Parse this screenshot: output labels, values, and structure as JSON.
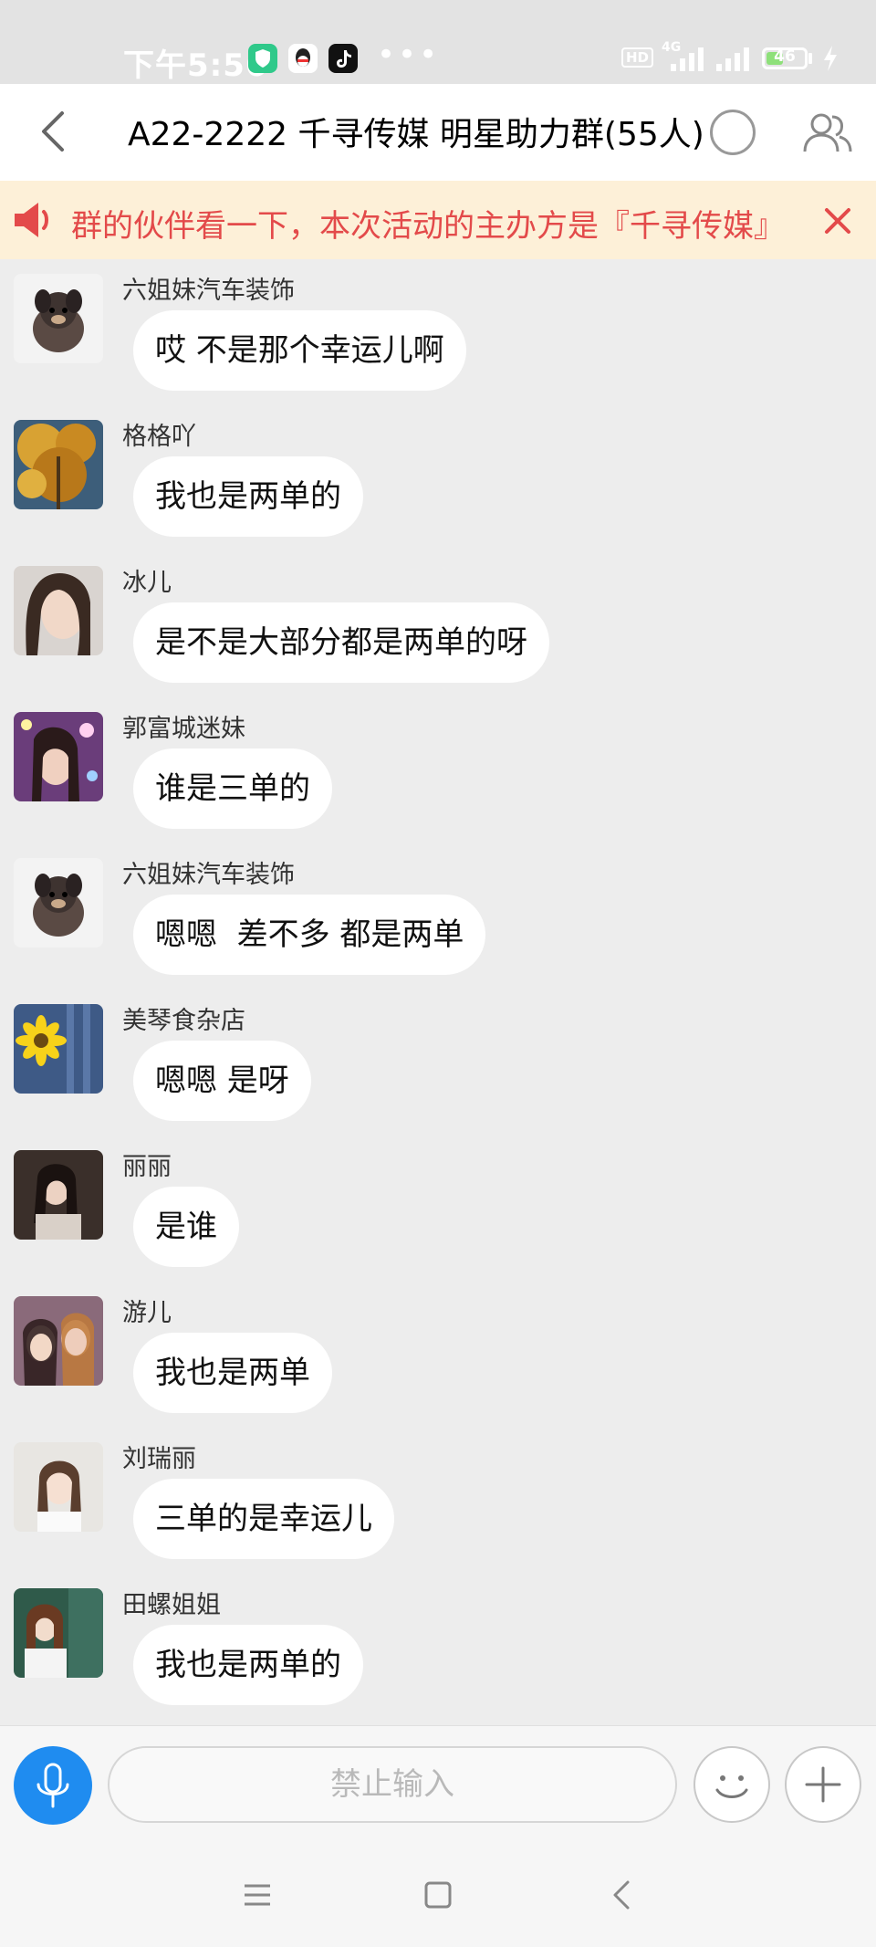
{
  "status_bar": {
    "time": "下午5:56",
    "network": "4G",
    "hd": "HD",
    "battery": "46",
    "battery_level": 0.46
  },
  "header": {
    "title": "A22-2222 千寻传媒 明星助力群(55人)"
  },
  "announcement": {
    "text": "群的伙伴看一下，本次活动的主办方是『千寻传媒』"
  },
  "messages": [
    {
      "name": "六姐妹汽车装饰",
      "text": "哎 不是那个幸运儿啊",
      "avatar": "puppy"
    },
    {
      "name": "格格吖",
      "text": "我也是两单的",
      "avatar": "autumn-tree"
    },
    {
      "name": "冰儿",
      "text": "是不是大部分都是两单的呀",
      "avatar": "woman-portrait"
    },
    {
      "name": "郭富城迷妹",
      "text": "谁是三单的",
      "avatar": "woman-concert"
    },
    {
      "name": "六姐妹汽车装饰",
      "text": "嗯嗯  差不多 都是两单",
      "avatar": "puppy"
    },
    {
      "name": "美琴食杂店",
      "text": "嗯嗯 是呀",
      "avatar": "sunflower"
    },
    {
      "name": "丽丽",
      "text": "是谁",
      "avatar": "woman-dark"
    },
    {
      "name": "游儿",
      "text": "我也是两单",
      "avatar": "two-women"
    },
    {
      "name": "刘瑞丽",
      "text": "三单的是幸运儿",
      "avatar": "woman-light"
    },
    {
      "name": "田螺姐姐",
      "text": "我也是两单的",
      "avatar": "woman-chalkboard"
    }
  ],
  "input": {
    "placeholder": "禁止输入"
  },
  "colors": {
    "accent": "#1f8cf0",
    "announcement_bg": "#fdf0d8",
    "announcement_text": "#e34a4a"
  },
  "icons": {
    "back": "back-arrow-icon",
    "members": "members-icon",
    "speaker": "speaker-icon",
    "close": "close-icon",
    "voice": "microphone-icon",
    "emoji": "emoji-icon",
    "plus": "plus-icon",
    "nav_menu": "menu-icon",
    "nav_home": "home-square-icon",
    "nav_back": "nav-back-icon"
  }
}
